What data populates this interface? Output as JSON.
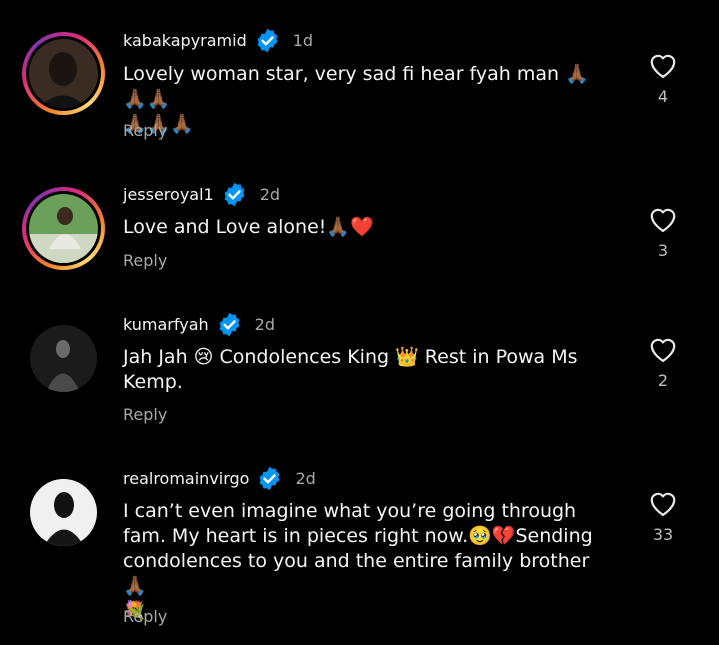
{
  "comments": [
    {
      "username": "kabakapyramid",
      "time": "1d",
      "text_lines": [
        "Lovely woman star, very sad fi hear fyah man 🙏🏾🙏🏾🙏🏾",
        "🙏🏾🙏🏾🙏🏾"
      ],
      "reply_label": "Reply",
      "likes": "4",
      "avatar_ring": true,
      "icon": "heart-outline-icon"
    },
    {
      "username": "jesseroyal1",
      "time": "2d",
      "text_lines": [
        "Love and Love alone!🙏🏾❤️"
      ],
      "reply_label": "Reply",
      "likes": "3",
      "avatar_ring": true,
      "icon": "heart-outline-icon"
    },
    {
      "username": "kumarfyah",
      "time": "2d",
      "text_lines": [
        "Jah Jah 😢 Condolences King 👑 Rest in Powa Ms",
        "Kemp."
      ],
      "reply_label": "Reply",
      "likes": "2",
      "avatar_ring": false,
      "icon": "heart-outline-icon"
    },
    {
      "username": "realromainvirgo",
      "time": "2d",
      "text_lines": [
        "I can’t even imagine what you’re going through",
        "fam. My heart is in pieces right now.🥹💔Sending",
        "condolences to you and the entire family brother 🙏🏾",
        "💐"
      ],
      "reply_label": "Reply",
      "likes": "33",
      "avatar_ring": false,
      "icon": "heart-outline-icon"
    }
  ],
  "colors": {
    "background": "#000000",
    "primary_text": "#f5f5f5",
    "secondary_text": "#a8a8a8",
    "verified_badge": "#0095f6"
  }
}
